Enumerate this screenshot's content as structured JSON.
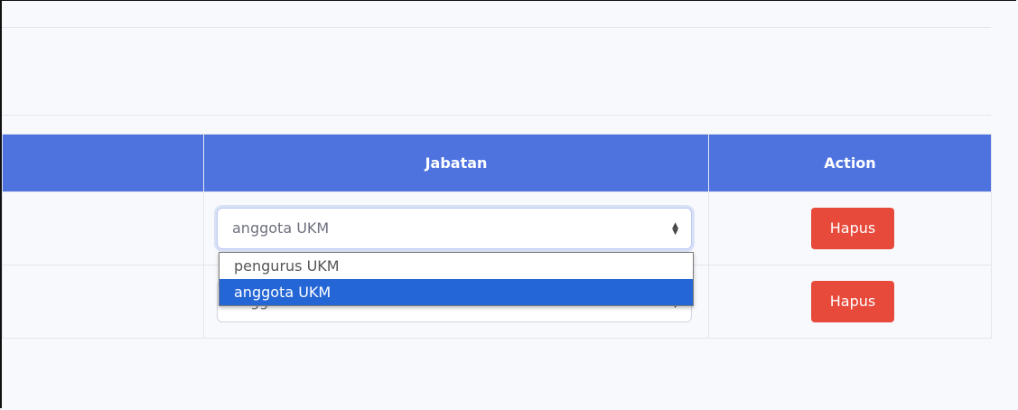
{
  "table": {
    "headers": [
      "",
      "Jabatan",
      "Action"
    ],
    "rows": [
      {
        "jabatan": "anggota UKM",
        "action": "Hapus"
      },
      {
        "jabatan": "anggota UKM",
        "action": "Hapus"
      }
    ]
  },
  "dropdown": {
    "options": [
      "pengurus UKM",
      "anggota UKM"
    ],
    "selected": "anggota UKM"
  },
  "icons": {
    "select_arrow": "sort-arrows-icon"
  },
  "colors": {
    "header_bg": "#4e73df",
    "danger": "#e74a3b",
    "option_highlight": "#2566d6"
  }
}
